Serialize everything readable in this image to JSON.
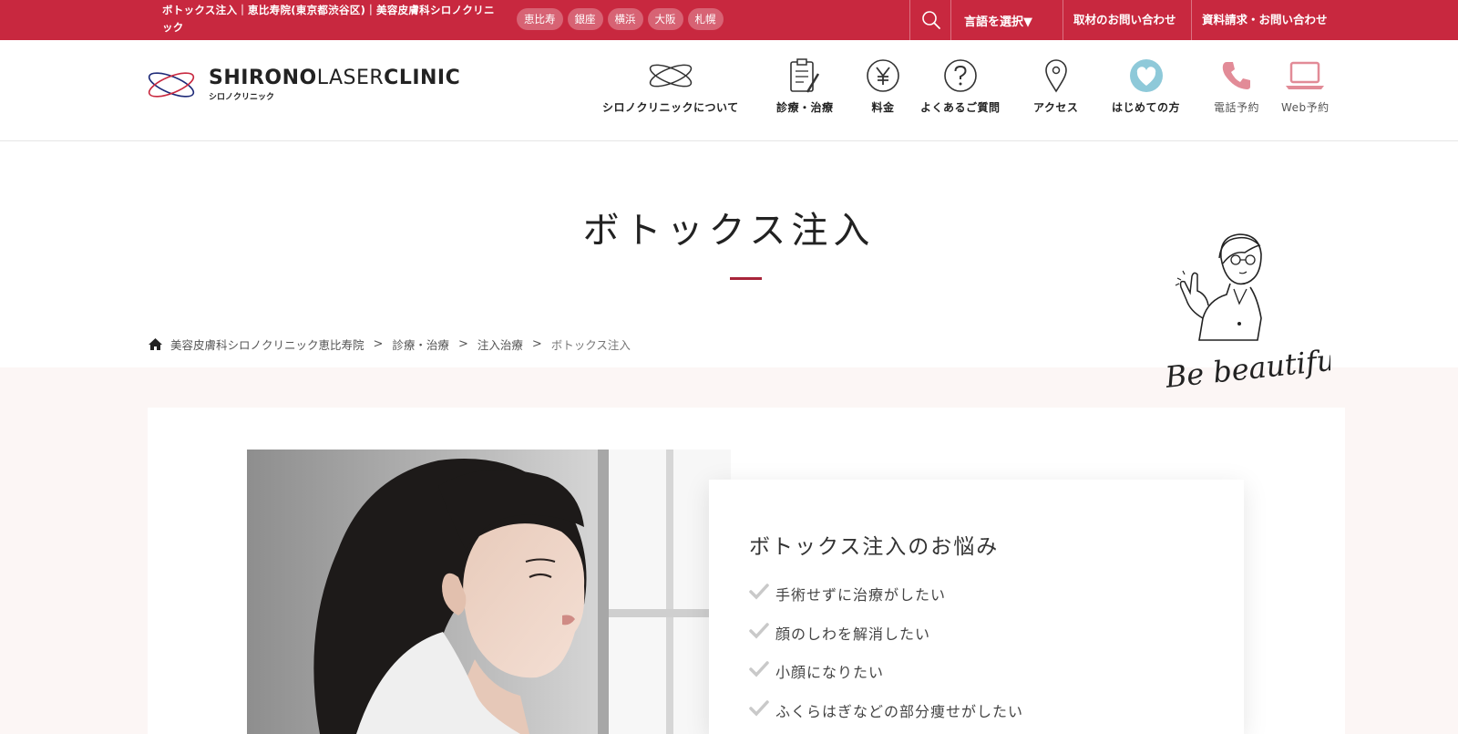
{
  "topbar": {
    "page_title": "ボトックス注入｜恵比寿院(東京都渋谷区)｜美容皮膚科シロノクリニック",
    "branches": [
      "恵比寿",
      "銀座",
      "横浜",
      "大阪",
      "札幌"
    ],
    "language_select": "言語を選択▼",
    "press_contact": "取材のお問い合わせ",
    "document_contact": "資料請求・お問い合わせ"
  },
  "header": {
    "logo_en_bold1": "SHIRONO",
    "logo_en_light": "LASER",
    "logo_en_bold2": "CLINIC",
    "logo_ja": "シロノクリニック",
    "nav": [
      {
        "label": "シロノクリニックについて",
        "icon": "clinic-logo-icon"
      },
      {
        "label": "診療・治療",
        "icon": "clipboard-pen-icon"
      },
      {
        "label": "料金",
        "icon": "yen-icon"
      },
      {
        "label": "よくあるご質問",
        "icon": "question-icon"
      },
      {
        "label": "アクセス",
        "icon": "location-pin-icon"
      },
      {
        "label": "はじめての方",
        "icon": "heart-icon"
      },
      {
        "label": "電話予約",
        "icon": "phone-icon"
      },
      {
        "label": "Web予約",
        "icon": "laptop-icon"
      }
    ]
  },
  "page": {
    "title": "ボトックス注入",
    "mascot_text": "Be beautiful!"
  },
  "breadcrumb": [
    "美容皮膚科シロノクリニック恵比寿院",
    "診療・治療",
    "注入治療",
    "ボトックス注入"
  ],
  "worries": {
    "heading": "ボトックス注入のお悩み",
    "items": [
      "手術せずに治療がしたい",
      "顔のしわを解消したい",
      "小顔になりたい",
      "ふくらはぎなどの部分痩せがしたい"
    ]
  },
  "colors": {
    "brand_red": "#c8283f",
    "accent_bar": "#a8243a",
    "section_bg": "#fcf6f5",
    "pink_icon": "#e28b97",
    "heart_blue": "#8ec9d9"
  }
}
